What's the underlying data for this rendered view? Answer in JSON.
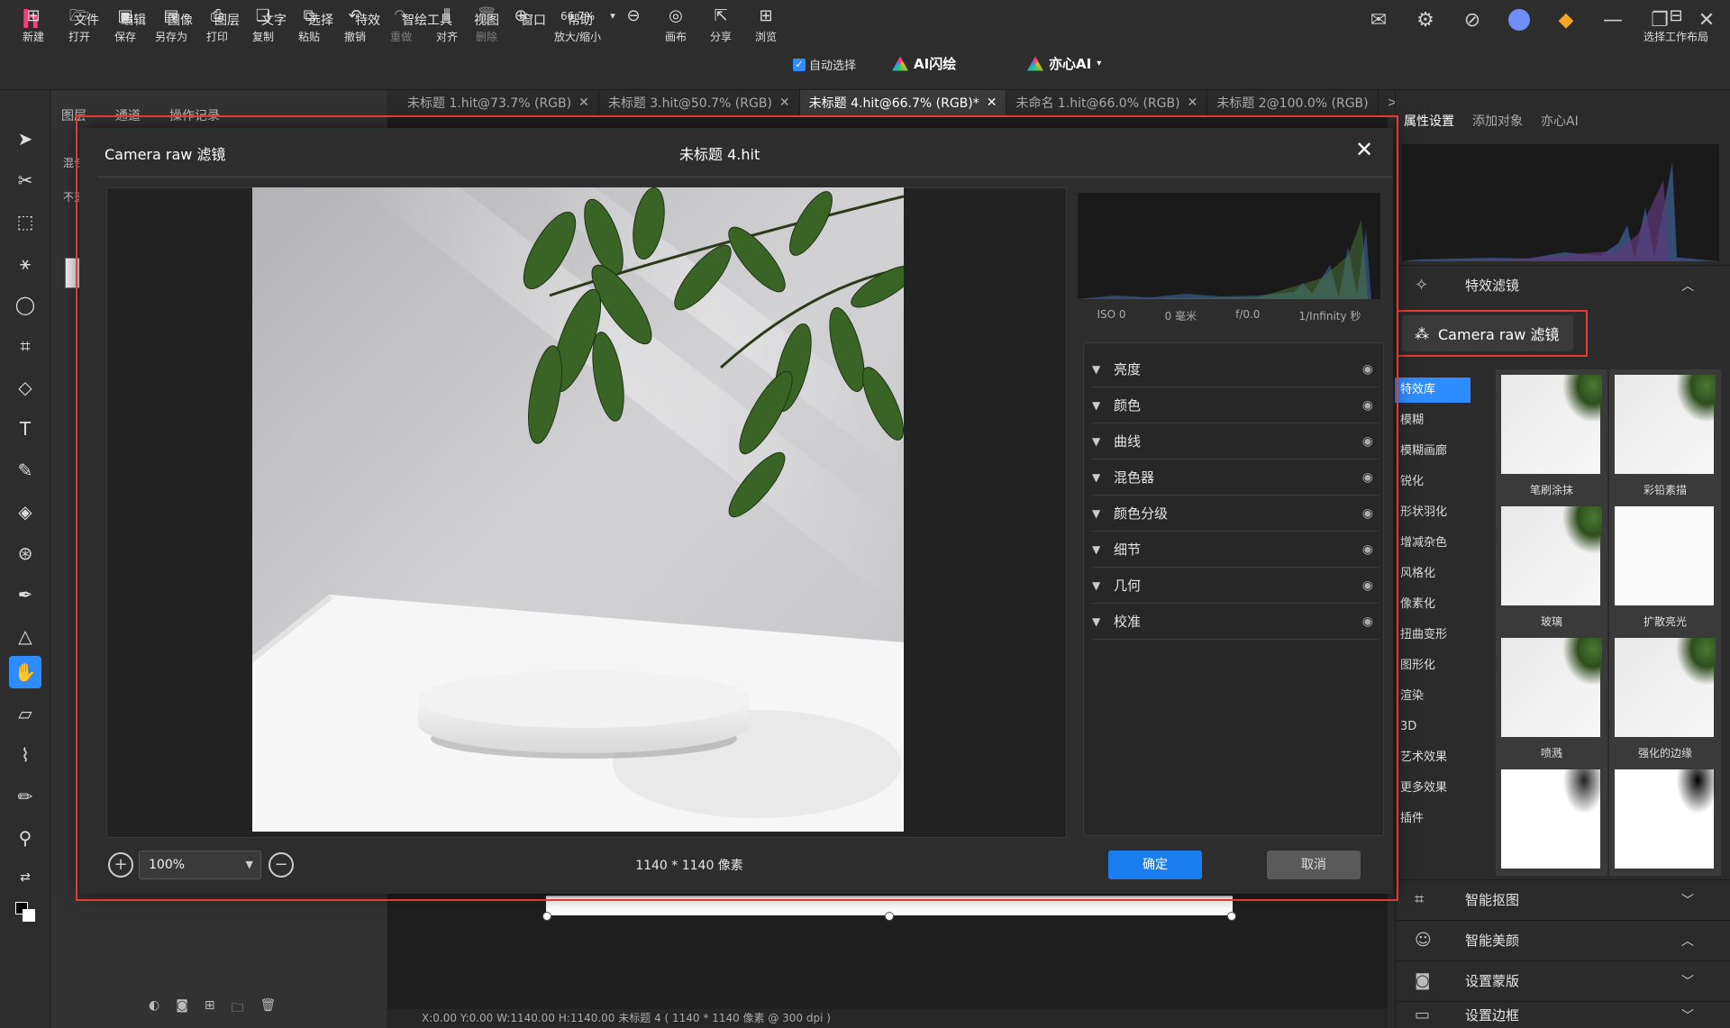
{
  "app": {
    "logo": "h"
  },
  "menu": [
    "文件",
    "编辑",
    "图像",
    "图层",
    "文字",
    "选择",
    "特效",
    "智绘工具",
    "视图",
    "窗口",
    "帮助"
  ],
  "toolbar": {
    "new": "新建",
    "open": "打开",
    "save": "保存",
    "save_as": "另存为",
    "print": "打印",
    "copy": "复制",
    "paste": "粘贴",
    "undo": "撤销",
    "redo": "重做",
    "align": "对齐",
    "delete": "删除",
    "zoom_value": "66.7%",
    "zoom_label": "放大/缩小",
    "canvas": "画布",
    "share": "分享",
    "browse": "浏览",
    "auto_select": "自动选择",
    "ai_flash": "AI闪绘",
    "yixin_ai": "亦心AI",
    "workspace": "选择工作布局"
  },
  "layers_panel": {
    "tabs": [
      "图层",
      "通道",
      "操作记录"
    ],
    "blend_mode": "混合模",
    "opacity": "不透明"
  },
  "doc_tabs": [
    {
      "label": "未标题 1.hit@73.7% (RGB)",
      "active": false
    },
    {
      "label": "未标题 3.hit@50.7% (RGB)",
      "active": false
    },
    {
      "label": "未标题 4.hit@66.7% (RGB)*",
      "active": true
    },
    {
      "label": "未命名 1.hit@66.0% (RGB)",
      "active": false
    },
    {
      "label": "未标题 2@100.0% (RGB)",
      "active": false
    }
  ],
  "doc_tabs_more": ">>",
  "right_panel": {
    "tabs": [
      "属性设置",
      "添加对象",
      "亦心AI"
    ],
    "fx_section": "特效滤镜",
    "camera_raw_button": "Camera raw 滤镜",
    "fx_categories": [
      "特效库",
      "模糊",
      "模糊画廊",
      "锐化",
      "形状羽化",
      "增减杂色",
      "风格化",
      "像素化",
      "扭曲变形",
      "图形化",
      "渲染",
      "3D",
      "艺术效果",
      "更多效果",
      "插件"
    ],
    "fx_thumbs": [
      "笔刷涂抹",
      "彩铅素描",
      "玻璃",
      "扩散亮光",
      "喷溅",
      "强化的边缘",
      "",
      ""
    ],
    "sections": [
      "智能抠图",
      "智能美颜",
      "设置蒙版",
      "设置边框"
    ]
  },
  "dialog": {
    "title": "Camera raw 滤镜",
    "doc_name": "未标题 4.hit",
    "close": "✕",
    "exif": [
      "ISO 0",
      "0 毫米",
      "f/0.0",
      "1/Infinity 秒"
    ],
    "adjustments": [
      "亮度",
      "颜色",
      "曲线",
      "混色器",
      "颜色分级",
      "细节",
      "几何",
      "校准"
    ],
    "zoom": "100%",
    "dimensions": "1140 * 1140 像素",
    "ok": "确定",
    "cancel": "取消"
  },
  "status": "X:0.00 Y:0.00 W:1140.00 H:1140.00    未标题 4 ( 1140 * 1140 像素 @ 300 dpi )",
  "colors": {
    "accent": "#2d8cff",
    "highlight_border": "#e53935",
    "ok_button": "#1a7ef0"
  }
}
